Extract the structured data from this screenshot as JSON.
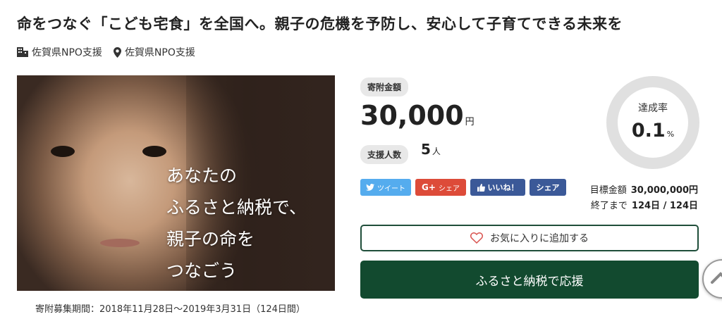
{
  "header": {
    "title": "命をつなぐ「こども宅食」を全国へ。親子の危機を予防し、安心して子育てできる未来を",
    "organization": "佐賀県NPO支援",
    "location": "佐賀県NPO支援"
  },
  "hero": {
    "lines": [
      "あなたの",
      "ふるさと納税で、",
      "親子の命を",
      "つなごう"
    ]
  },
  "period": "寄附募集期間：2018年11月28日～2019年3月31日（124日間）",
  "donation": {
    "label": "寄附金額",
    "amount": "30,000",
    "amount_unit": "円",
    "supporters_label": "支援人数",
    "supporters": "5",
    "supporters_unit": "人"
  },
  "social": {
    "tweet": "ツイート",
    "gplus_mark": "G+",
    "gplus": "シェア",
    "like": "いいね！",
    "share": "シェア"
  },
  "progress": {
    "label": "達成率",
    "value": "0.1",
    "unit": "%",
    "fraction": 0.001
  },
  "goal": {
    "target_label": "目標金額",
    "target_value": "30,000,000円",
    "remaining_label": "終了まで",
    "remaining_value": "124日 / 124日"
  },
  "actions": {
    "favorite": "お気に入りに追加する",
    "support": "ふるさと納税で応援"
  },
  "colors": {
    "brand_green": "#124a2f",
    "twitter": "#55acee",
    "googleplus": "#dd4b39",
    "facebook": "#3b5998",
    "ring": "#e0e0e0"
  },
  "icons": [
    "building-icon",
    "location-pin-icon",
    "twitter-bird-icon",
    "thumbs-up-icon",
    "heart-icon",
    "chevron-up-icon"
  ]
}
